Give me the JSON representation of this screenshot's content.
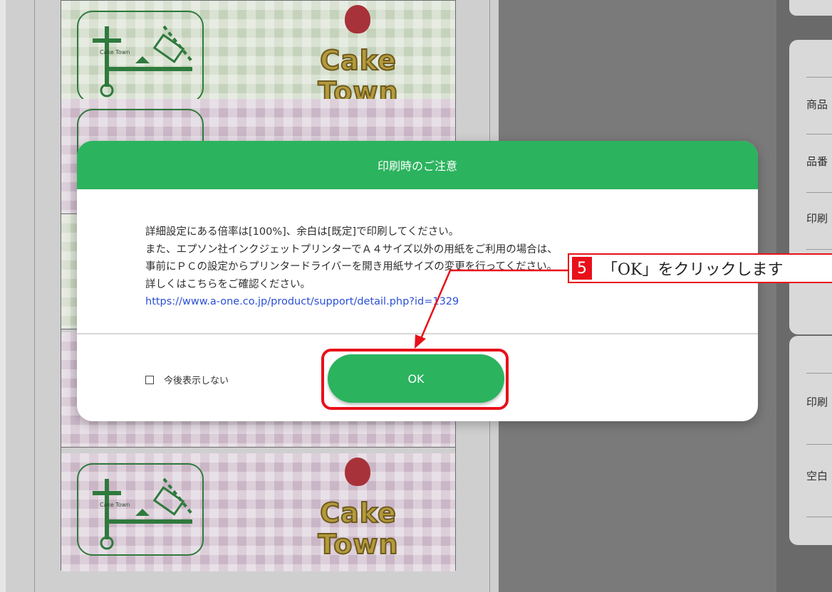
{
  "background": {
    "labels": [
      {
        "theme": "green",
        "map_caption": "Cake Town",
        "logo": "Cake Town"
      },
      {
        "theme": "pink",
        "map_caption": "",
        "logo": ""
      },
      {
        "theme": "green",
        "map_caption": "",
        "logo": ""
      },
      {
        "theme": "pink",
        "map_caption": "",
        "logo": ""
      },
      {
        "theme": "pink",
        "map_caption": "Cake Town",
        "logo": "Cake Town"
      }
    ],
    "right_panel": {
      "card1_rows": [
        "商品",
        "品番",
        "印刷"
      ],
      "card2_rows": [
        "印刷",
        "空白"
      ]
    }
  },
  "modal": {
    "title": "印刷時のご注意",
    "lines": [
      "詳細設定にある倍率は[100%]、余白は[既定]で印刷してください。",
      "また、エプソン社インクジェットプリンターでＡ４サイズ以外の用紙をご利用の場合は、",
      "事前にＰＣの設定からプリンタードライバーを開き用紙サイズの変更を行ってください。",
      "詳しくはこちらをご確認ください。"
    ],
    "link": "https://www.a-one.co.jp/product/support/detail.php?id=1329",
    "checkbox_label": "今後表示しない",
    "checkbox_checked": false,
    "ok_label": "OK"
  },
  "annotation": {
    "step_number": "5",
    "text": "「OK」をクリックします",
    "color": "#e8101a"
  },
  "colors": {
    "accent_green": "#2bb35e",
    "link_blue": "#2b4fd6"
  }
}
